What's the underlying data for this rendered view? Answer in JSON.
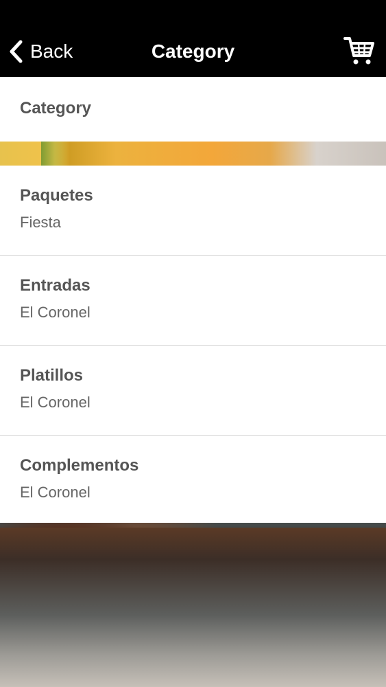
{
  "nav": {
    "back_label": "Back",
    "title": "Category"
  },
  "header": {
    "label": "Category"
  },
  "categories": [
    {
      "title": "Paquetes",
      "subtitle": "Fiesta"
    },
    {
      "title": "Entradas",
      "subtitle": "El Coronel"
    },
    {
      "title": "Platillos",
      "subtitle": "El Coronel"
    },
    {
      "title": "Complementos",
      "subtitle": "El Coronel"
    }
  ],
  "colors": {
    "navbar": "#000000",
    "text": "#555555",
    "divider": "#d5d5d5"
  },
  "icons": {
    "back": "chevron-left-icon",
    "cart": "shopping-cart-icon"
  }
}
